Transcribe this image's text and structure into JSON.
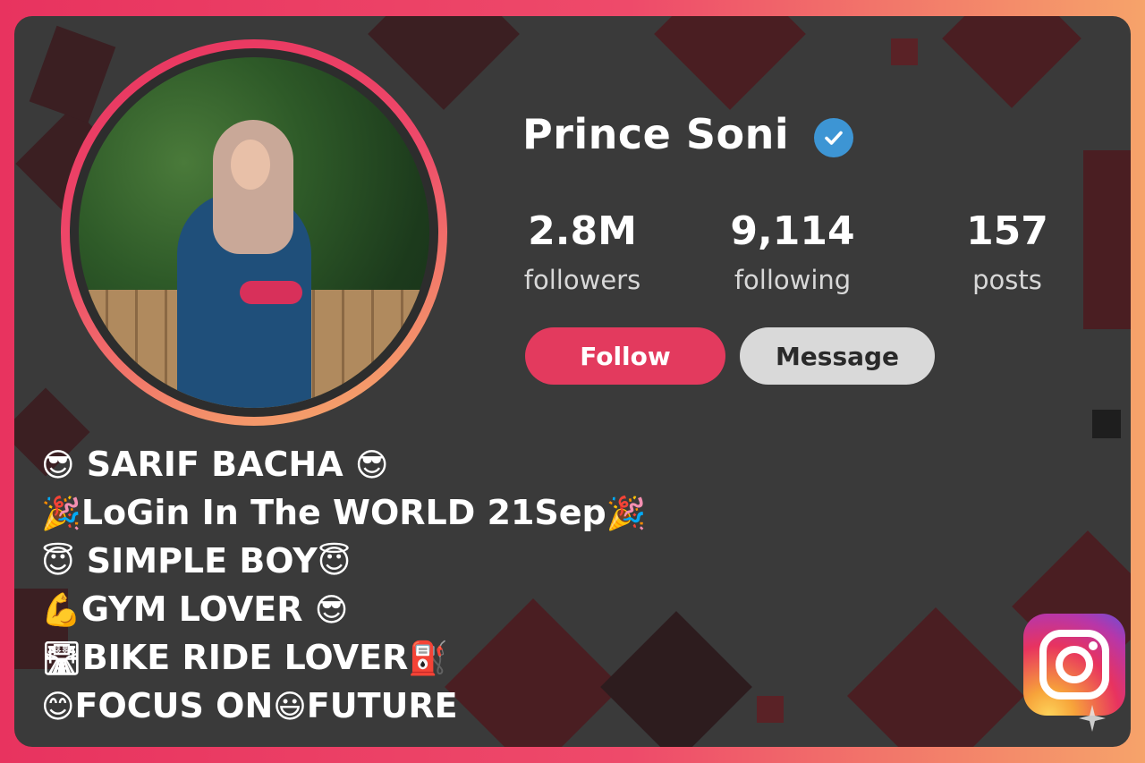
{
  "profile": {
    "username": "Prince Soni",
    "verified": true,
    "verified_icon": "verified-badge-icon",
    "avatar_icon": "profile-photo",
    "stats": [
      {
        "value": "2.8M",
        "label": "followers"
      },
      {
        "value": "9,114",
        "label": "following"
      },
      {
        "value": "157",
        "label": "posts"
      }
    ],
    "buttons": {
      "follow": "Follow",
      "message": "Message"
    }
  },
  "bio": {
    "lines": [
      {
        "lead": "😎",
        "text": " SARIF BACHA ",
        "trail": "😎"
      },
      {
        "lead": "🎉",
        "text": "LoGin In The WORLD 21Sep",
        "trail": "🎉"
      },
      {
        "lead": "😇",
        "text": " SIMPLE BOY",
        "trail": "😇"
      },
      {
        "lead": "💪",
        "text": "GYM LOVER ",
        "trail": "😎"
      },
      {
        "lead": "🛣",
        "text": "BIKE RIDE LOVER",
        "trail": "⛽"
      },
      {
        "lead": "😊",
        "text": "FOCUS ON",
        "trail": "😃",
        "after": "FUTURE"
      }
    ]
  },
  "branding": {
    "logo_icon": "instagram-logo-icon"
  },
  "colors": {
    "follow": "#e33a5e",
    "message": "#d9d9d9",
    "verified": "#3d95d4",
    "frame_start": "#e8335f",
    "frame_end": "#f6a36a",
    "card_bg": "#3a3a3a"
  }
}
